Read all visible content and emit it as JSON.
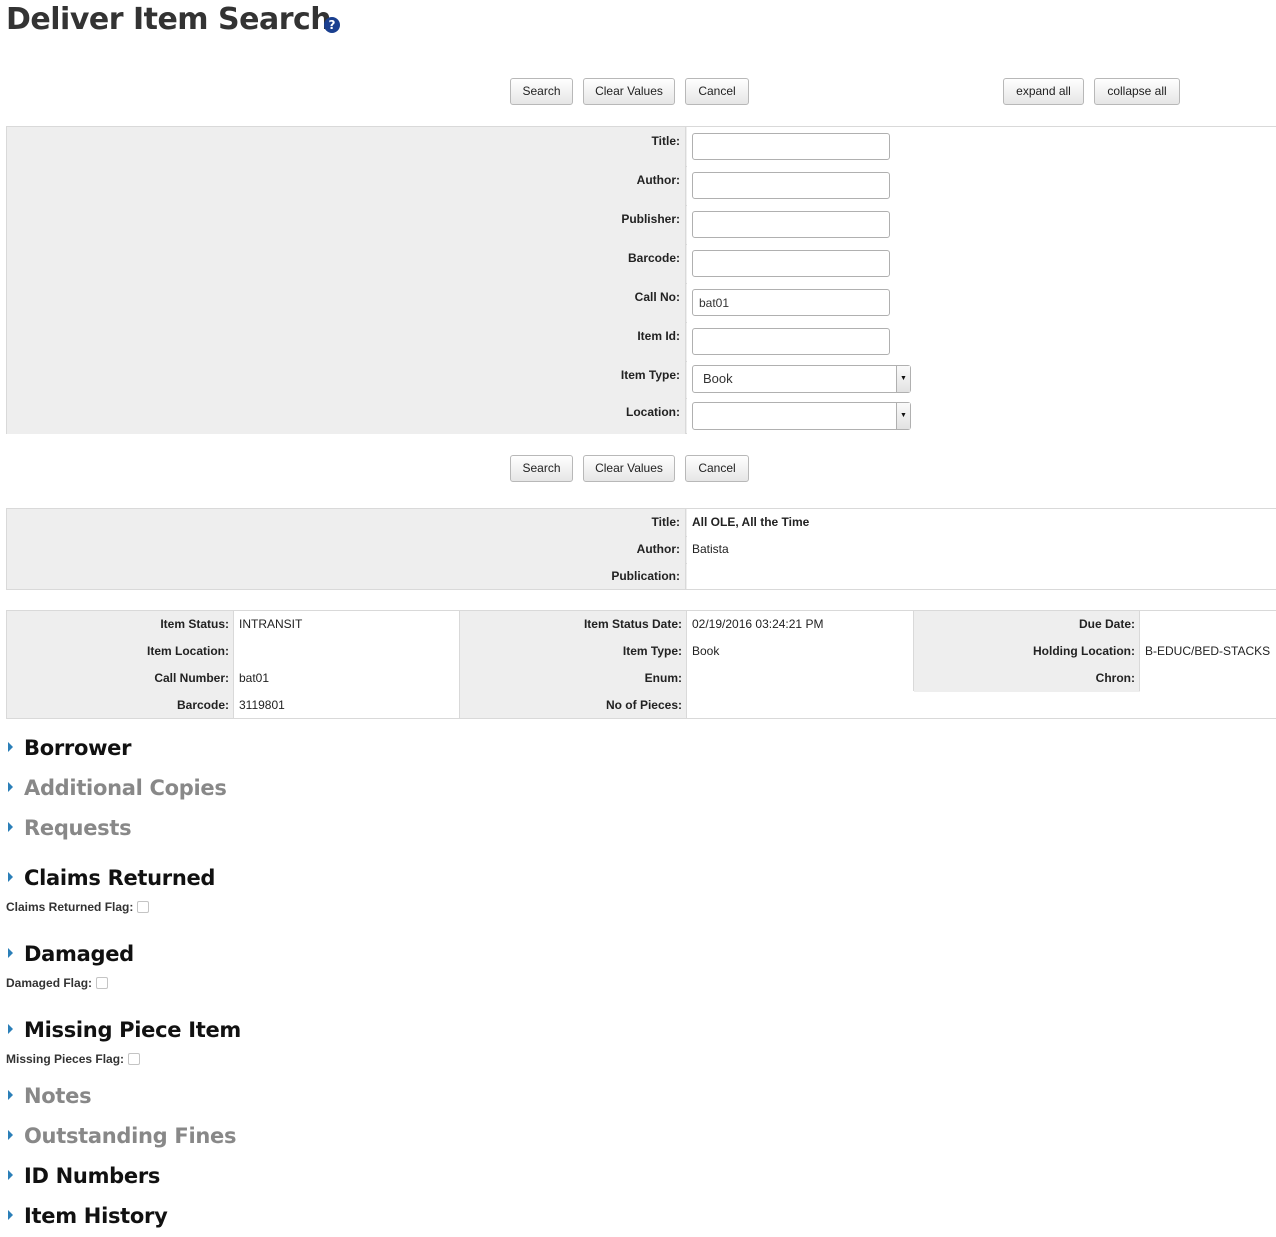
{
  "page": {
    "title": "Deliver Item Search",
    "help_icon": "question-circle-icon"
  },
  "toolbar": {
    "search": "Search",
    "clear": "Clear Values",
    "cancel": "Cancel",
    "expand_all": "expand all",
    "collapse_all": "collapse all"
  },
  "search_form": {
    "title": {
      "label": "Title:",
      "value": ""
    },
    "author": {
      "label": "Author:",
      "value": ""
    },
    "publisher": {
      "label": "Publisher:",
      "value": ""
    },
    "barcode": {
      "label": "Barcode:",
      "value": ""
    },
    "call_no": {
      "label": "Call No:",
      "value": "bat01"
    },
    "item_id": {
      "label": "Item Id:",
      "value": ""
    },
    "item_type": {
      "label": "Item Type:",
      "value": "Book"
    },
    "location": {
      "label": "Location:",
      "value": ""
    }
  },
  "bottom_toolbar": {
    "search": "Search",
    "clear": "Clear Values",
    "cancel": "Cancel"
  },
  "bib_info": {
    "title": {
      "label": "Title:",
      "value": "All OLE, All the Time"
    },
    "author": {
      "label": "Author:",
      "value": "Batista"
    },
    "publication": {
      "label": "Publication:",
      "value": ""
    }
  },
  "item_info": {
    "item_status": {
      "label": "Item Status:",
      "value": "INTRANSIT"
    },
    "item_status_date": {
      "label": "Item Status Date:",
      "value": "02/19/2016 03:24:21 PM"
    },
    "due_date": {
      "label": "Due Date:",
      "value": ""
    },
    "item_location": {
      "label": "Item Location:",
      "value": ""
    },
    "item_type": {
      "label": "Item Type:",
      "value": "Book"
    },
    "holding_location": {
      "label": "Holding Location:",
      "value": "B-EDUC/BED-STACKS"
    },
    "call_number": {
      "label": "Call Number:",
      "value": "bat01"
    },
    "enum": {
      "label": "Enum:",
      "value": ""
    },
    "chron": {
      "label": "Chron:",
      "value": ""
    },
    "barcode": {
      "label": "Barcode:",
      "value": "3119801"
    },
    "no_of_pieces": {
      "label": "No of Pieces:",
      "value": ""
    }
  },
  "sections": {
    "borrower": "Borrower",
    "additional_copies": "Additional Copies",
    "requests": "Requests",
    "claims_returned": "Claims Returned",
    "claims_returned_flag": "Claims Returned Flag:",
    "damaged": "Damaged",
    "damaged_flag": "Damaged Flag:",
    "missing_piece_item": "Missing Piece Item",
    "missing_pieces_flag": "Missing Pieces Flag:",
    "notes": "Notes",
    "outstanding_fines": "Outstanding Fines",
    "id_numbers": "ID Numbers",
    "item_history": "Item History"
  },
  "colors": {
    "accent": "#2b7fb8",
    "label_bg": "#eeeeee",
    "muted_heading": "#888888"
  }
}
